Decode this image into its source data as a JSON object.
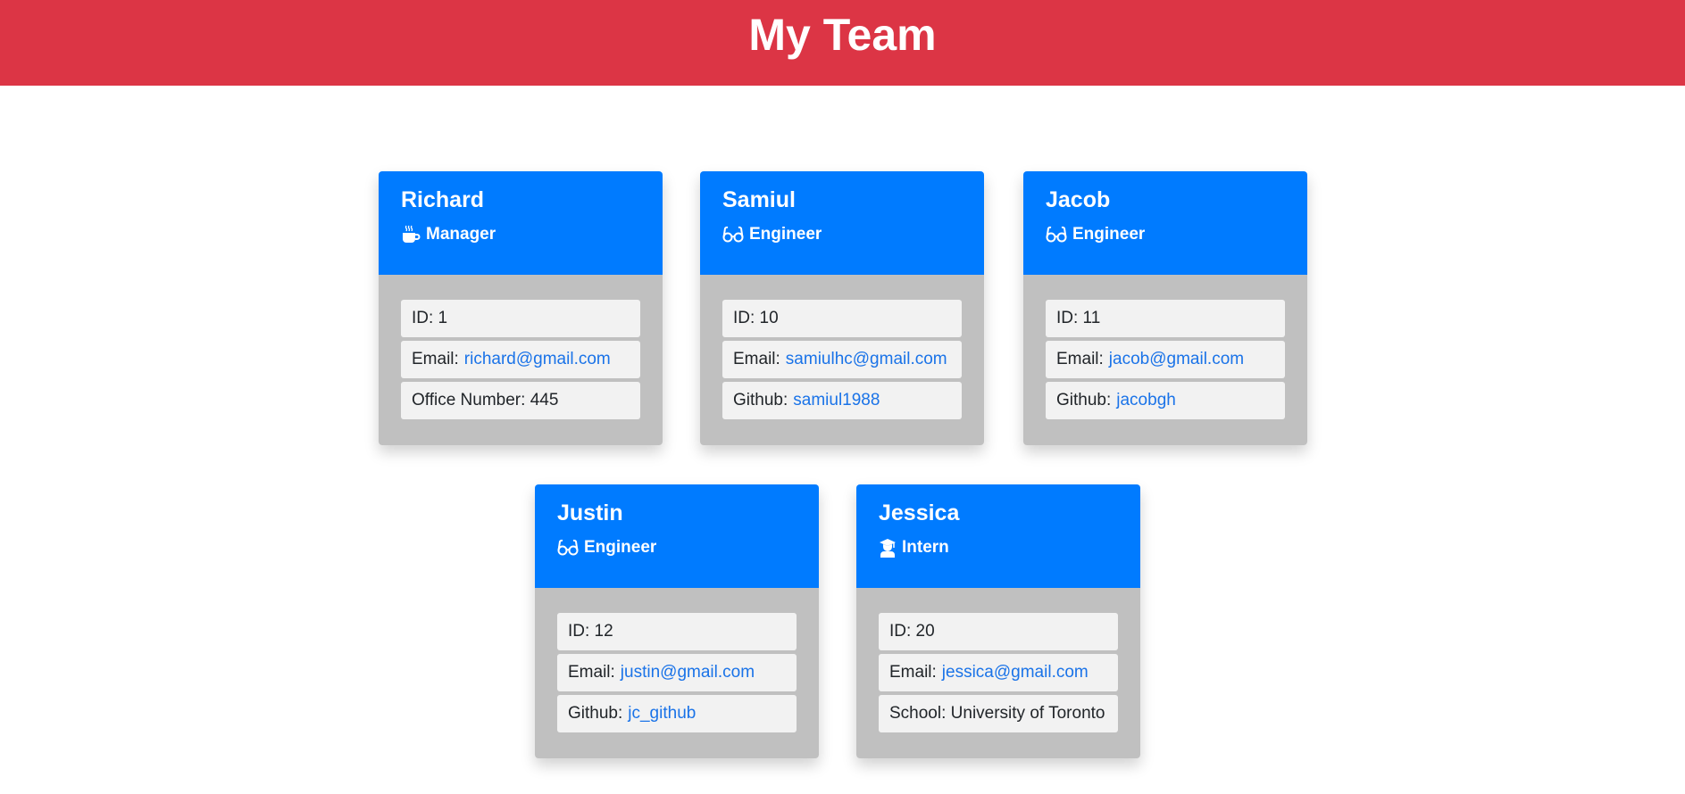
{
  "page": {
    "title": "My Team"
  },
  "colors": {
    "header_bg": "#dc3545",
    "card_header_bg": "#007bff",
    "card_body_bg": "#c0c0c0",
    "row_bg": "#f2f2f2",
    "link": "#1a73e8"
  },
  "members": [
    {
      "name": "Richard",
      "role": "Manager",
      "role_icon": "coffee-mug-icon",
      "id_text": "ID: 1",
      "email_label": "Email:",
      "email": "richard@gmail.com",
      "extra_label": "Office Number: 445",
      "extra_link": ""
    },
    {
      "name": "Samiul",
      "role": "Engineer",
      "role_icon": "glasses-icon",
      "id_text": "ID: 10",
      "email_label": "Email:",
      "email": "samiulhc@gmail.com",
      "extra_label": "Github:",
      "extra_link": "samiul1988"
    },
    {
      "name": "Jacob",
      "role": "Engineer",
      "role_icon": "glasses-icon",
      "id_text": "ID: 11",
      "email_label": "Email:",
      "email": "jacob@gmail.com",
      "extra_label": "Github:",
      "extra_link": "jacobgh"
    },
    {
      "name": "Justin",
      "role": "Engineer",
      "role_icon": "glasses-icon",
      "id_text": "ID: 12",
      "email_label": "Email:",
      "email": "justin@gmail.com",
      "extra_label": "Github:",
      "extra_link": "jc_github"
    },
    {
      "name": "Jessica",
      "role": "Intern",
      "role_icon": "graduate-icon",
      "id_text": "ID: 20",
      "email_label": "Email:",
      "email": "jessica@gmail.com",
      "extra_label": "School: University of Toronto",
      "extra_link": ""
    }
  ]
}
